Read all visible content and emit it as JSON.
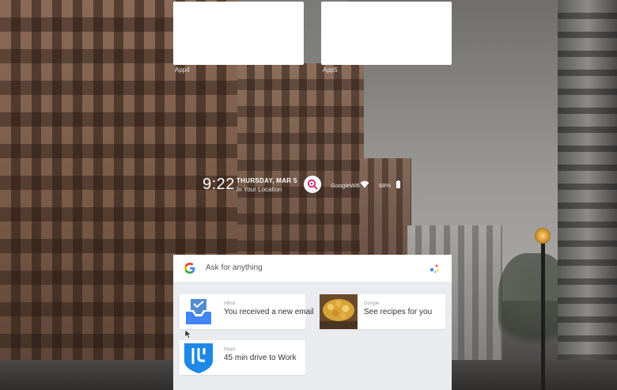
{
  "apps": [
    {
      "label": "App4"
    },
    {
      "label": "App5"
    }
  ],
  "status": {
    "time": "9:22",
    "date": "THURSDAY, MAR 5",
    "location": "In Your Location",
    "wifi_name": "GoogleWifi",
    "battery": "68%"
  },
  "search": {
    "placeholder": "Ask for anything"
  },
  "cards": [
    {
      "source": "Inbox",
      "title": "You received a new email",
      "icon": "inbox-icon"
    },
    {
      "source": "Google",
      "title": "See recipes for you",
      "icon": "food-photo"
    },
    {
      "source": "Maps",
      "title": "45 min drive to Work",
      "icon": "maps-route-icon"
    }
  ],
  "colors": {
    "google_blue": "#4285F4",
    "google_red": "#EA4335",
    "google_yellow": "#FBBC05",
    "google_green": "#34A853",
    "inbox_blue": "#4285F4",
    "maps_blue": "#1E88E5",
    "assistant_pink": "#D81B60"
  }
}
